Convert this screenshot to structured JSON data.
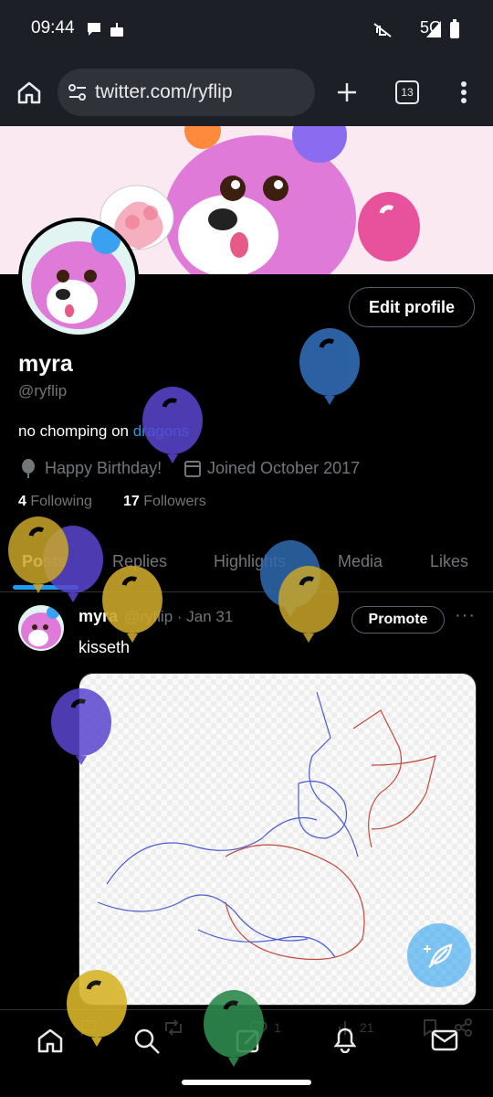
{
  "status_bar": {
    "time": "09:44",
    "network": "5G"
  },
  "browser": {
    "url": "twitter.com/ryflip",
    "tab_count": "13"
  },
  "profile": {
    "edit_label": "Edit profile",
    "name": "myra",
    "handle": "@ryflip",
    "bio_prefix": "no chomping on ",
    "bio_link": "dragons",
    "birthday": "Happy Birthday!",
    "joined": "Joined October 2017",
    "following_count": "4",
    "following_label": "Following",
    "followers_count": "17",
    "followers_label": "Followers"
  },
  "tabs": [
    {
      "label": "Posts"
    },
    {
      "label": "Replies"
    },
    {
      "label": "Highlights"
    },
    {
      "label": "Media"
    },
    {
      "label": "Likes"
    }
  ],
  "post": {
    "name": "myra",
    "meta": "@ryflip · Jan 31",
    "promote_label": "Promote",
    "more": "···",
    "text": "kisseth",
    "likes": "1",
    "views": "21"
  },
  "colors": {
    "accent": "#1d9bf0",
    "background": "#000000",
    "muted": "#71767b",
    "banner": "#fbe9f2",
    "fur_pink": "#e07ad8"
  },
  "icons": [
    "home-icon",
    "settings-sliders-icon",
    "plus-icon",
    "tabs-icon",
    "kebab-icon",
    "location-balloon-icon",
    "calendar-icon",
    "search-icon",
    "notifications-icon",
    "messages-icon",
    "compose-icon",
    "share-icon",
    "bookmark-icon",
    "retweet-icon",
    "reply-icon",
    "heart-icon",
    "views-icon"
  ]
}
